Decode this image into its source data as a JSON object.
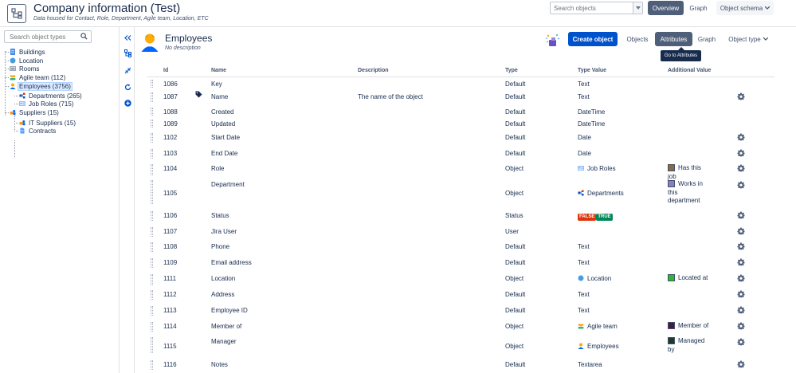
{
  "header": {
    "title": "Company information (Test)",
    "subtitle": "Data housed for Contact, Role, Department, Agile team, Location, ETC",
    "search_placeholder": "Search objects",
    "overview_label": "Overview",
    "graph_label": "Graph",
    "object_schema_label": "Object schema"
  },
  "sidebar": {
    "search_placeholder": "Search object types",
    "items": [
      {
        "label": "Buildings",
        "icon": "building-icon"
      },
      {
        "label": "Location",
        "icon": "globe-icon"
      },
      {
        "label": "Rooms",
        "icon": "room-icon"
      },
      {
        "label": "Agile team (112)",
        "icon": "team-icon"
      },
      {
        "label": "Employees (3756)",
        "icon": "person-icon"
      },
      {
        "label": "Departments (265)",
        "icon": "departments-icon"
      },
      {
        "label": "Job Roles (715)",
        "icon": "id-card-icon"
      },
      {
        "label": "Suppliers (15)",
        "icon": "suppliers-icon"
      },
      {
        "label": "IT Suppliers (15)",
        "icon": "suppliers-icon"
      },
      {
        "label": "Contracts",
        "icon": "document-icon"
      }
    ]
  },
  "object_type": {
    "title": "Employees",
    "description": "No description",
    "create_label": "Create object",
    "tabs": {
      "objects": "Objects",
      "attributes": "Attributes",
      "graph": "Graph",
      "object_type": "Object type"
    },
    "tooltip": "Go to Attributes"
  },
  "table": {
    "headers": {
      "id": "Id",
      "name": "Name",
      "description": "Description",
      "type": "Type",
      "type_value": "Type Value",
      "additional": "Additional Value"
    },
    "rows": [
      {
        "id": "1086",
        "name": "Key",
        "description": "",
        "type": "Default",
        "type_value": "Text",
        "additional": "",
        "gear": false,
        "label_icon": false
      },
      {
        "id": "1087",
        "name": "Name",
        "description": "The name of the object",
        "type": "Default",
        "type_value": "Text",
        "additional": "",
        "gear": true,
        "label_icon": true
      },
      {
        "id": "1088",
        "name": "Created",
        "description": "",
        "type": "Default",
        "type_value": "DateTime",
        "additional": "",
        "gear": false
      },
      {
        "id": "1089",
        "name": "Updated",
        "description": "",
        "type": "Default",
        "type_value": "DateTime",
        "additional": "",
        "gear": false
      },
      {
        "id": "1102",
        "name": "Start Date",
        "description": "",
        "type": "Default",
        "type_value": "Date",
        "additional": "",
        "gear": true
      },
      {
        "id": "1103",
        "name": "End Date",
        "description": "",
        "type": "Default",
        "type_value": "Date",
        "additional": "",
        "gear": true
      },
      {
        "id": "1104",
        "name": "Role",
        "description": "",
        "type": "Object",
        "type_value": "Job Roles",
        "type_value_icon": "id-card-icon",
        "additional": "Has this job",
        "swatch": "#8b6b3d",
        "gear": true
      },
      {
        "id": "1105",
        "name": "Department",
        "description": "",
        "type": "Object",
        "type_value": "Departments",
        "type_value_icon": "departments-icon",
        "additional": "Works in this department",
        "swatch": "#8e7cc3",
        "gear": true
      },
      {
        "id": "1106",
        "name": "Status",
        "description": "",
        "type": "Status",
        "type_value": "",
        "status_badges": [
          "FALSE",
          "TRUE"
        ],
        "additional": "",
        "gear": true
      },
      {
        "id": "1107",
        "name": "Jira User",
        "description": "",
        "type": "User",
        "type_value": "",
        "additional": "",
        "gear": true
      },
      {
        "id": "1108",
        "name": "Phone",
        "description": "",
        "type": "Default",
        "type_value": "Text",
        "additional": "",
        "gear": true
      },
      {
        "id": "1109",
        "name": "Email address",
        "description": "",
        "type": "Default",
        "type_value": "Text",
        "additional": "",
        "gear": true
      },
      {
        "id": "1111",
        "name": "Location",
        "description": "",
        "type": "Object",
        "type_value": "Location",
        "type_value_icon": "globe-icon",
        "additional": "Located at",
        "swatch": "#2eb82e",
        "gear": true
      },
      {
        "id": "1112",
        "name": "Address",
        "description": "",
        "type": "Default",
        "type_value": "Text",
        "additional": "",
        "gear": true
      },
      {
        "id": "1113",
        "name": "Employee ID",
        "description": "",
        "type": "Default",
        "type_value": "Text",
        "additional": "",
        "gear": true
      },
      {
        "id": "1114",
        "name": "Member of",
        "description": "",
        "type": "Object",
        "type_value": "Agile team",
        "type_value_icon": "team-icon",
        "additional": "Member of",
        "swatch": "#4a1942",
        "gear": true
      },
      {
        "id": "1115",
        "name": "Manager",
        "description": "",
        "type": "Object",
        "type_value": "Employees",
        "type_value_icon": "person-icon",
        "additional": "Managed by",
        "swatch": "#1e3b2a",
        "gear": true
      },
      {
        "id": "1116",
        "name": "Notes",
        "description": "",
        "type": "Default",
        "type_value": "Textarea",
        "additional": "",
        "gear": true
      }
    ]
  },
  "colors": {
    "primary": "#0052cc",
    "selected_tab": "#505f79",
    "false_badge": "#de350b",
    "true_badge": "#00875a"
  }
}
